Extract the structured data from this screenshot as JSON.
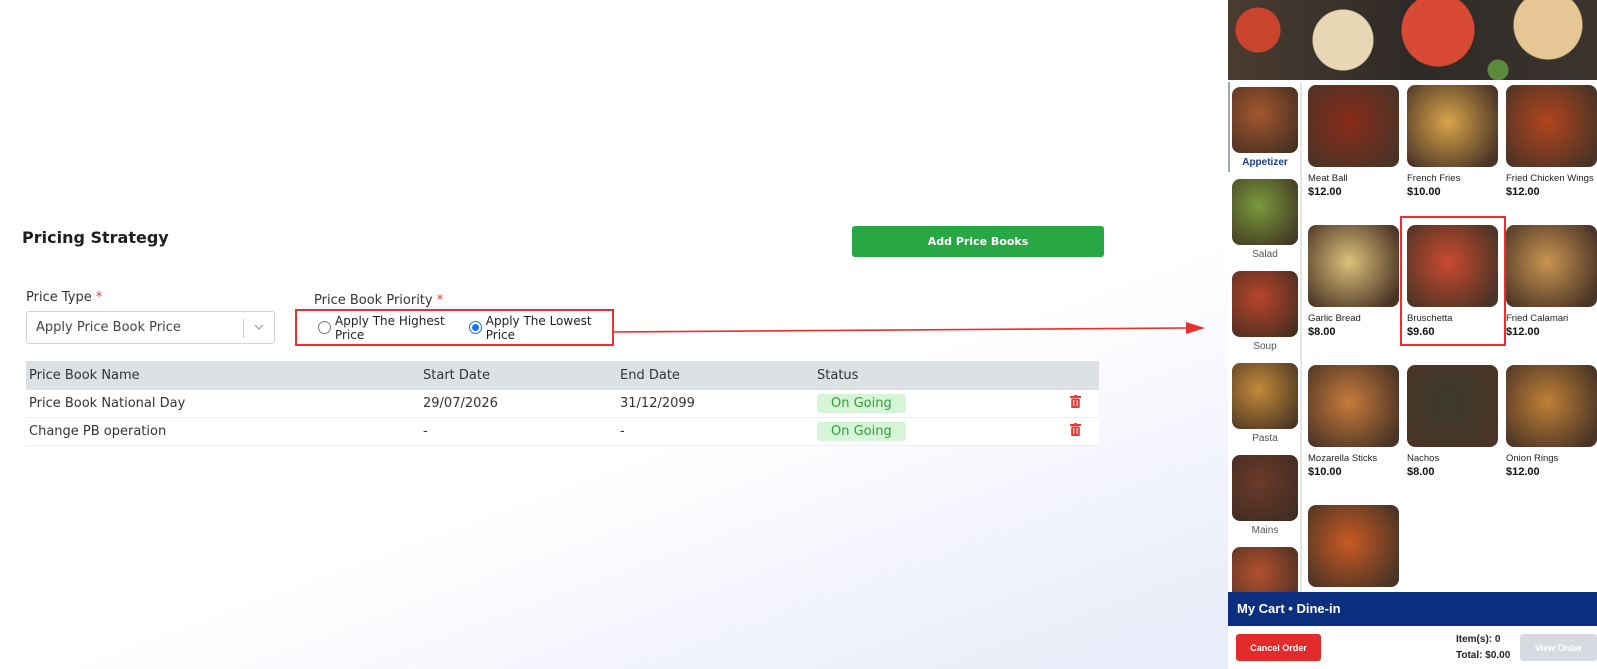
{
  "pricing": {
    "title": "Pricing Strategy",
    "add_button": "Add Price Books",
    "price_type_label": "Price Type",
    "price_type_value": "Apply Price Book Price",
    "priority_label": "Price Book Priority",
    "required_mark": "*",
    "radio_options": [
      {
        "label": "Apply The Highest Price",
        "checked": false
      },
      {
        "label": "Apply The Lowest Price",
        "checked": true
      }
    ],
    "table": {
      "headers": [
        "Price Book Name",
        "Start Date",
        "End Date",
        "Status"
      ],
      "rows": [
        {
          "name": "Price Book National Day",
          "start": "29/07/2026",
          "end": "31/12/2099",
          "status": "On Going"
        },
        {
          "name": "Change PB operation",
          "start": "-",
          "end": "-",
          "status": "On Going"
        }
      ]
    }
  },
  "pos": {
    "categories": [
      {
        "label": "Appetizer",
        "active": true,
        "color": "#a4572f"
      },
      {
        "label": "Salad",
        "active": false,
        "color": "#7a9a3c"
      },
      {
        "label": "Soup",
        "active": false,
        "color": "#b8452a"
      },
      {
        "label": "Pasta",
        "active": false,
        "color": "#c48a3a"
      },
      {
        "label": "Mains",
        "active": false,
        "color": "#6b3a2a"
      },
      {
        "label": "",
        "active": false,
        "color": "#b5512e"
      }
    ],
    "products": [
      {
        "name": "Meat Ball",
        "price": "$12.00",
        "color": "#8a2a1a"
      },
      {
        "name": "French Fries",
        "price": "$10.00",
        "color": "#d9a54a"
      },
      {
        "name": "Fried Chicken Wings",
        "price": "$12.00",
        "color": "#b2441d"
      },
      {
        "name": "Garlic Bread",
        "price": "$8.00",
        "color": "#dcc17a"
      },
      {
        "name": "Bruschetta",
        "price": "$9.60",
        "color": "#c94a2e"
      },
      {
        "name": "Fried Calamari",
        "price": "$12.00",
        "color": "#c99450"
      },
      {
        "name": "Mozarella Sticks",
        "price": "$10.00",
        "color": "#c87a3a"
      },
      {
        "name": "Nachos",
        "price": "$8.00",
        "color": "#3b3a2c"
      },
      {
        "name": "Onion Rings",
        "price": "$12.00",
        "color": "#c08035"
      },
      {
        "name": "",
        "price": "",
        "color": "#c95a22"
      }
    ],
    "cart": {
      "title": "My Cart • Dine-in",
      "cancel": "Cancel Order",
      "items": "Item(s): 0",
      "total": "Total: $0.00",
      "view": "View Order"
    }
  }
}
